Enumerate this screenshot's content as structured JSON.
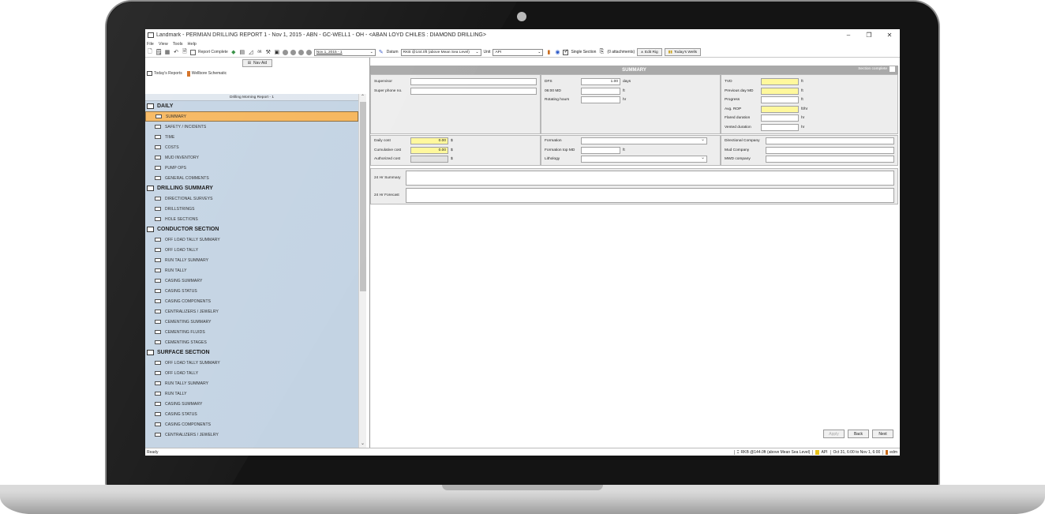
{
  "window": {
    "title": "Landmark - PERMIAN DRILLING REPORT   1 - Nov 1, 2015 - ABN - GC-WELL1 - OH - <ABAN LOYD CHILES : DIAMOND DRILLING>",
    "minimize": "–",
    "maximize": "❐",
    "close": "✕"
  },
  "menu": [
    "File",
    "View",
    "Tools",
    "Help"
  ],
  "toolbar": {
    "report_complete": "Report Complete",
    "date_value": "Nov 1, 2015 - 1",
    "datum_label": "Datum",
    "datum_value": "RKB @144.0ft (above Mean Sea Level)",
    "unit_label": "Unit",
    "unit_value": "API",
    "single_section": "Single Section",
    "attachments": "(0 attachments)",
    "edit_rig": "Edit Rig",
    "todays_wells": "Today's Wells"
  },
  "nav": {
    "nav_aid": "Nav Aid",
    "tab_reports": "Today's Reports",
    "tab_wellbore": "Wellbore Schematic",
    "tree_header": "Drilling Morning Report -  1",
    "items": [
      {
        "type": "section",
        "label": "DAILY"
      },
      {
        "type": "item",
        "label": "SUMMARY",
        "selected": true
      },
      {
        "type": "item",
        "label": "SAFETY / INCIDENTS"
      },
      {
        "type": "item",
        "label": "TIME"
      },
      {
        "type": "item",
        "label": "COSTS"
      },
      {
        "type": "item",
        "label": "MUD INVENTORY"
      },
      {
        "type": "item",
        "label": "PUMP OPS"
      },
      {
        "type": "item",
        "label": "GENERAL COMMENTS"
      },
      {
        "type": "section",
        "label": "DRILLING SUMMARY"
      },
      {
        "type": "item",
        "label": "DIRECTIONAL SURVEYS"
      },
      {
        "type": "item",
        "label": "DRILLSTRINGS"
      },
      {
        "type": "item",
        "label": "HOLE SECTIONS"
      },
      {
        "type": "section",
        "label": "CONDUCTOR SECTION"
      },
      {
        "type": "item",
        "label": "OFF LOAD TALLY SUMMARY"
      },
      {
        "type": "item",
        "label": "OFF LOAD TALLY"
      },
      {
        "type": "item",
        "label": "RUN TALLY SUMMARY"
      },
      {
        "type": "item",
        "label": "RUN TALLY"
      },
      {
        "type": "item",
        "label": "CASING SUMMARY"
      },
      {
        "type": "item",
        "label": "CASING STATUS"
      },
      {
        "type": "item",
        "label": "CASING COMPONENTS"
      },
      {
        "type": "item",
        "label": "CENTRALIZERS / JEWELRY"
      },
      {
        "type": "item",
        "label": "CEMENTING SUMMARY"
      },
      {
        "type": "item",
        "label": "CEMENTING FLUIDS"
      },
      {
        "type": "item",
        "label": "CEMENTING STAGES"
      },
      {
        "type": "section",
        "label": "SURFACE SECTION"
      },
      {
        "type": "item",
        "label": "OFF LOAD TALLY SUMMARY"
      },
      {
        "type": "item",
        "label": "OFF LOAD TALLY"
      },
      {
        "type": "item",
        "label": "RUN TALLY SUMMARY"
      },
      {
        "type": "item",
        "label": "RUN TALLY"
      },
      {
        "type": "item",
        "label": "CASING SUMMARY"
      },
      {
        "type": "item",
        "label": "CASING STATUS"
      },
      {
        "type": "item",
        "label": "CASING COMPONENTS"
      },
      {
        "type": "item",
        "label": "CENTRALIZERS / JEWELRY"
      }
    ]
  },
  "summary": {
    "header": "SUMMARY",
    "section_complete": "Section complete",
    "supervisor_label": "Supervisor",
    "supervisor_value": "",
    "super_phone_label": "Super phone no.",
    "super_phone_value": "",
    "dfs_label": "DFS",
    "dfs_value": "1.00",
    "dfs_unit": "days",
    "md_label": "06:00 MD",
    "md_value": "",
    "md_unit": "ft",
    "rotating_label": "Rotating hours",
    "rotating_value": "",
    "rotating_unit": "hr",
    "tvd_label": "TVD",
    "tvd_unit": "ft",
    "prev_md_label": "Previous day MD",
    "prev_md_unit": "ft",
    "progress_label": "Progress",
    "progress_unit": "ft",
    "avg_rop_label": "Avg. ROP",
    "avg_rop_unit": "ft/hr",
    "flared_label": "Flared duration",
    "flared_unit": "hr",
    "vented_label": "Vented duration",
    "vented_unit": "hr",
    "daily_cost_label": "Daily cost",
    "daily_cost_value": "0.00",
    "daily_cost_unit": "$",
    "cum_cost_label": "Cumulative cost",
    "cum_cost_value": "0.00",
    "cum_cost_unit": "$",
    "auth_cost_label": "Authorized cost",
    "auth_cost_value": "",
    "auth_cost_unit": "$",
    "formation_label": "Formation",
    "formation_top_label": "Formation top MD",
    "formation_top_unit": "ft",
    "lithology_label": "Lithology",
    "dir_company_label": "Directional Company",
    "mud_company_label": "Mud Company",
    "mwd_company_label": "MWD company",
    "summary_24_label": "24 Hr Summary",
    "forecast_24_label": "24 Hr Forecast"
  },
  "buttons": {
    "apply": "Apply",
    "back": "Back",
    "next": "Next"
  },
  "status": {
    "left": "Ready",
    "datum": "RKB @144.0ft (above Mean Sea Level)",
    "unit": "API",
    "range": "Oct 31, 6:00 to Nov 1, 6:00",
    "user": "edm"
  },
  "colors": {
    "selected_nav": "#f6b55a",
    "nav_bg": "#c3d3e3",
    "required_field": "#fff89c",
    "summary_header": "#a9a9a9"
  }
}
